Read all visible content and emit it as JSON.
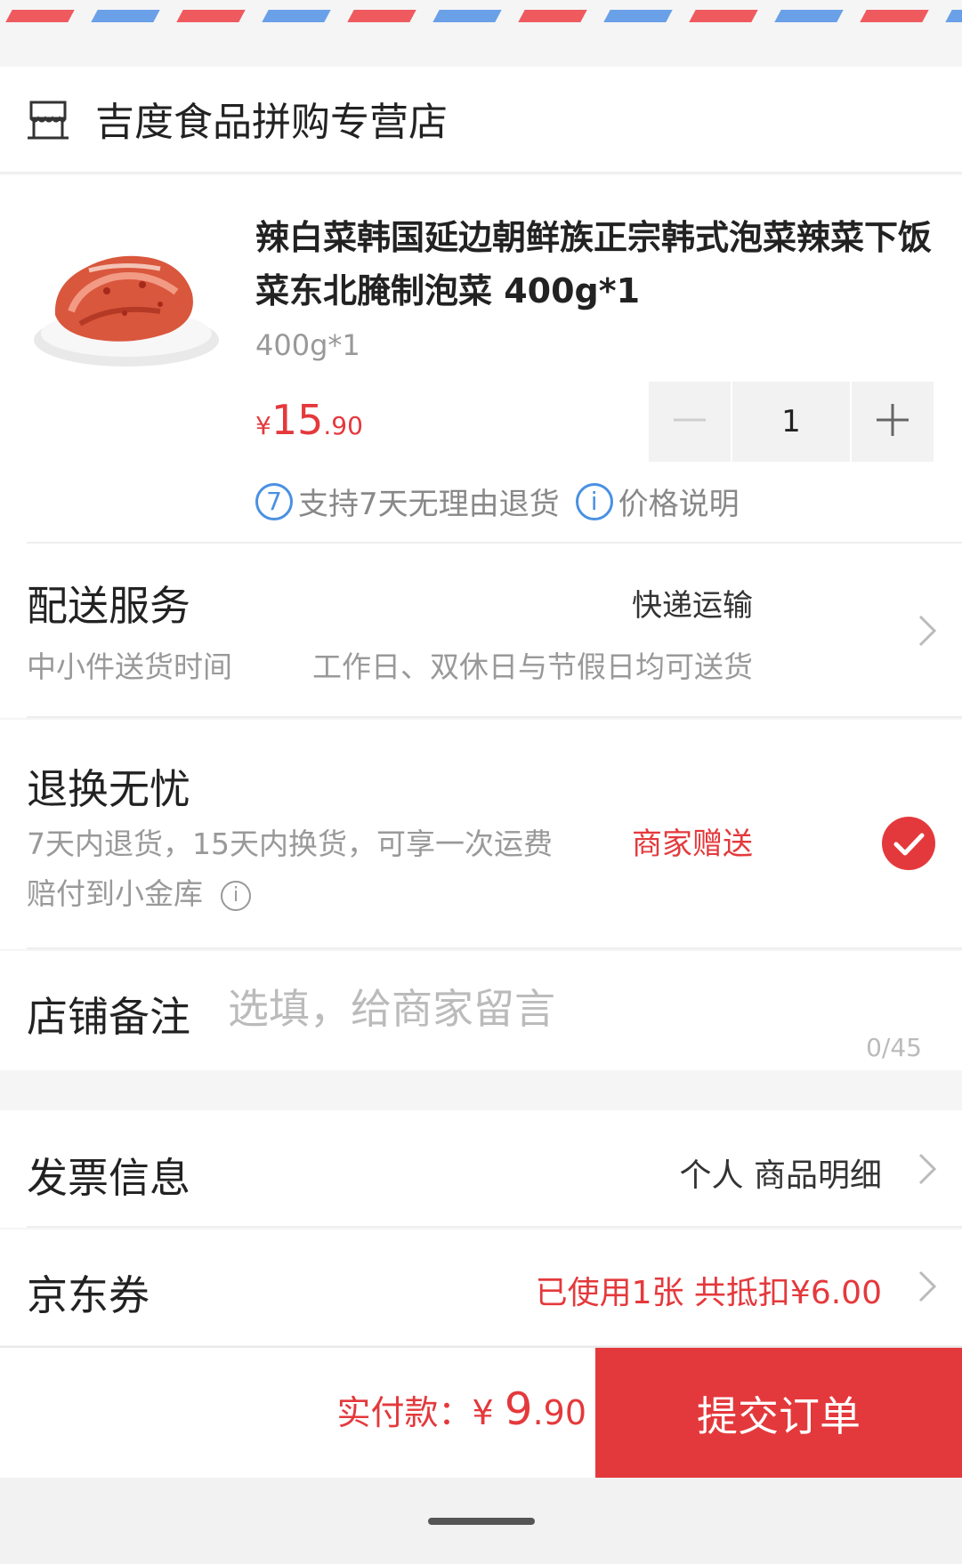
{
  "shop": {
    "name": "吉度食品拼购专营店",
    "icon": "store-icon"
  },
  "product": {
    "title": "辣白菜韩国延边朝鲜族正宗韩式泡菜辣菜下饭菜东北腌制泡菜 400g*1",
    "spec": "400g*1",
    "price_symbol": "¥",
    "price_integer": "15",
    "price_decimal": ".90",
    "quantity": "1",
    "badges": [
      {
        "icon_text": "7",
        "label": "支持7天无理由退货"
      },
      {
        "icon_text": "i",
        "label": "价格说明"
      }
    ]
  },
  "delivery": {
    "title": "配送服务",
    "method": "快递运输",
    "sub_label": "中小件送货时间",
    "sub_value": "工作日、双休日与节假日均可送货"
  },
  "returns": {
    "title": "退换无忧",
    "description": "7天内退货，15天内换货，可享一次运费赔付到小金库",
    "info_icon_text": "i",
    "gift_label": "商家赠送"
  },
  "remark": {
    "label": "店铺备注",
    "placeholder": "选填，给商家留言",
    "counter": "0/45"
  },
  "invoice": {
    "label": "发票信息",
    "value": "个人 商品明细"
  },
  "coupon": {
    "label": "京东券",
    "value": "已使用1张 共抵扣¥6.00"
  },
  "footer": {
    "total_label": "实付款：",
    "total_symbol": "¥",
    "total_integer": "9",
    "total_decimal": ".90",
    "submit_label": "提交订单"
  },
  "colors": {
    "accent": "#e4393c",
    "link_blue": "#4a90e2",
    "airmail_red": "#ef5a5f",
    "airmail_blue": "#6aa0e8"
  }
}
